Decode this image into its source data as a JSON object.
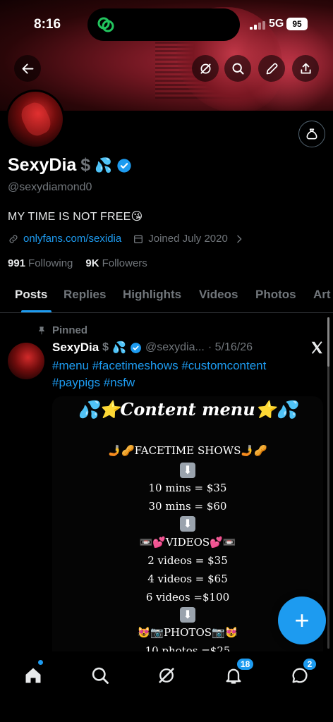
{
  "status_bar": {
    "time": "8:16",
    "network": "5G",
    "battery": "95"
  },
  "profile": {
    "name": "SexyDia",
    "name_dollar": "$",
    "name_emoji": "💦",
    "handle": "@sexydiamond0",
    "bio": "MY TIME IS NOT FREE😘",
    "link": "onlyfans.com/sexidia",
    "joined": "Joined July 2020",
    "following_count": "991",
    "following_label": "Following",
    "followers_count": "9K",
    "followers_label": "Followers"
  },
  "tabs": [
    "Posts",
    "Replies",
    "Highlights",
    "Videos",
    "Photos",
    "Art"
  ],
  "active_tab": "Posts",
  "post": {
    "pinned_label": "Pinned",
    "author": "SexyDia",
    "author_dollar": "$",
    "author_emoji": "💦",
    "handle": "@sexydia...",
    "date": "· 5/16/26",
    "hashtags_line1": "#menu #facetimeshows #customcontent",
    "hashtags_line2": "#paypigs #nsfw",
    "menu": {
      "title": "💦⭐Content menu⭐💦",
      "facetime_heading": "🤳🥜FACETIME SHOWS🤳🥜",
      "arrow": "⬇",
      "facetime_1": "10 mins = $35",
      "facetime_2": "30 mins = $60",
      "videos_heading": "📼💕VIDEOS💕📼",
      "videos_1": "2 videos = $35",
      "videos_2": "4 videos = $65",
      "videos_3": "6 videos =$100",
      "photos_heading": "😻📷PHOTOS📷😻",
      "photos_1": "10 photos =$25"
    }
  },
  "fab_label": "+",
  "bottom_nav": {
    "notifications_badge": "18",
    "messages_badge": "2"
  },
  "colors": {
    "accent": "#1d9bf0",
    "muted": "#71767b",
    "text": "#e7e9ea",
    "divider": "#2f3336"
  }
}
